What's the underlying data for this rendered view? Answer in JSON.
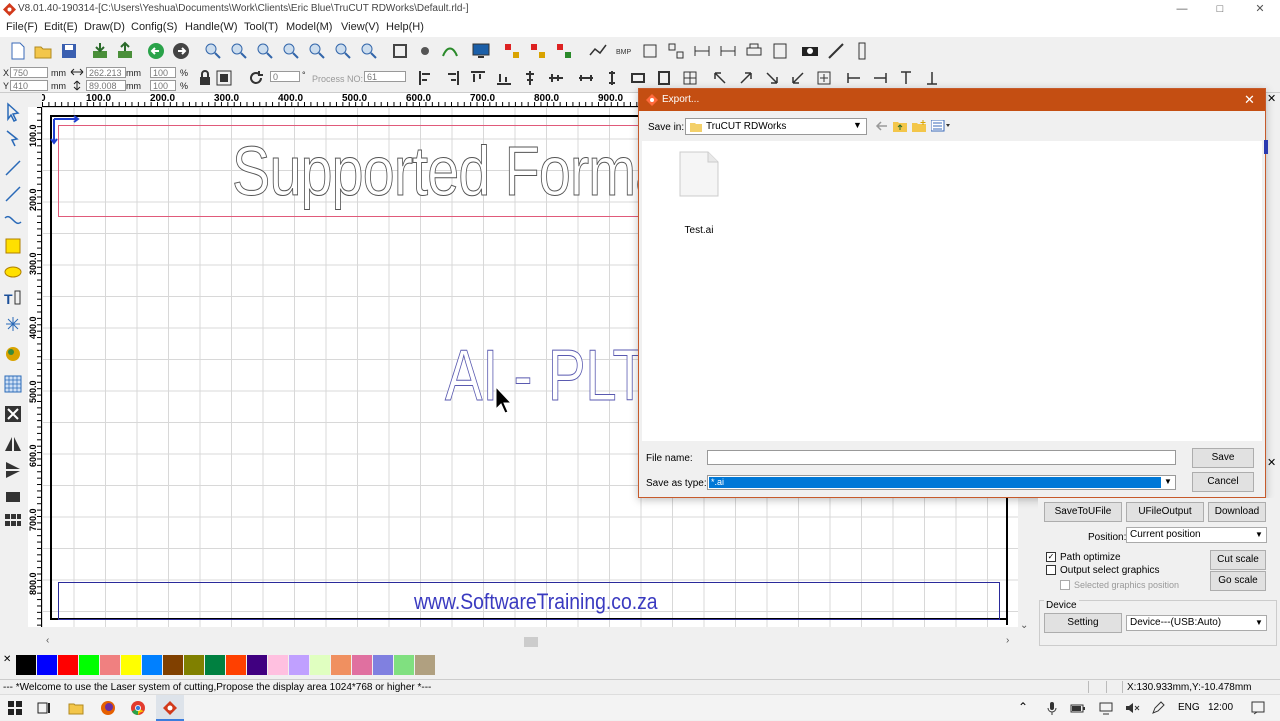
{
  "window": {
    "title": "V8.01.40-190314-[C:\\Users\\Yeshua\\Documents\\Work\\Clients\\Eric Blue\\TruCUT RDWorks\\Default.rld-]"
  },
  "menu": [
    "File(F)",
    "Edit(E)",
    "Draw(D)",
    "Config(S)",
    "Handle(W)",
    "Tool(T)",
    "Model(M)",
    "View(V)",
    "Help(H)"
  ],
  "coords": {
    "x_label": "X",
    "x_value": "750",
    "x_unit": "mm",
    "y_label": "Y",
    "y_value": "410",
    "y_unit": "mm",
    "w_value": "262.213",
    "w_unit": "mm",
    "h_value": "89.008",
    "h_unit": "mm",
    "sx_value": "100",
    "sy_value": "100",
    "pct": "%",
    "angle_value": "0",
    "deg": "°",
    "process_label": "Process NO:",
    "process_value": "61"
  },
  "ruler_top": [
    "100.0",
    "200.0",
    "300.0",
    "400.0",
    "500.0",
    "600.0",
    "700.0",
    "800.0",
    "900.0"
  ],
  "ruler_left": [
    "100.0",
    "200.0",
    "300.0",
    "400.0",
    "500.0",
    "600.0",
    "700.0",
    "800.0"
  ],
  "canvas": {
    "heading": "Supported Formats",
    "mid_text": "AI - PLT",
    "footer_text": "www.SoftwareTraining.co.za"
  },
  "palette": [
    "#000000",
    "#0000ff",
    "#ff0000",
    "#00ff00",
    "#f08080",
    "#ffff00",
    "#0080ff",
    "#804000",
    "#808000",
    "#008040",
    "#ff4000",
    "#400080",
    "#ffc0e0",
    "#c0a0ff",
    "#e0ffc0",
    "#f09060",
    "#e070a0",
    "#8080e0",
    "#80e080",
    "#b0a080"
  ],
  "status": {
    "message": "--- *Welcome to use the Laser system of cutting,Propose the display area 1024*768 or higher *---",
    "cursor": "X:130.933mm,Y:-10.478mm"
  },
  "dialog": {
    "title": "Export...",
    "save_in_label": "Save in:",
    "save_in_value": "TruCUT RDWorks",
    "file_item": "Test.ai",
    "file_name_label": "File name:",
    "file_name_value": "",
    "save_as_type_label": "Save as type:",
    "save_as_type_value": "*.ai",
    "save_button": "Save",
    "cancel_button": "Cancel"
  },
  "right_panel": {
    "save_to_ufile": "SaveToUFile",
    "ufile_output": "UFileOutput",
    "download": "Download",
    "position_label": "Position:",
    "position_value": "Current position",
    "path_optimize": "Path optimize",
    "output_select": "Output select graphics",
    "selected_position": "Selected graphics position",
    "cut_scale": "Cut scale",
    "go_scale": "Go scale",
    "device_label": "Device",
    "setting": "Setting",
    "device_value": "Device---(USB:Auto)"
  },
  "taskbar": {
    "lang": "ENG",
    "time": "12:00"
  },
  "colors": {
    "accent": "#c44e12",
    "selection": "#0078d7",
    "canvas_text": "#3a3a9a"
  }
}
